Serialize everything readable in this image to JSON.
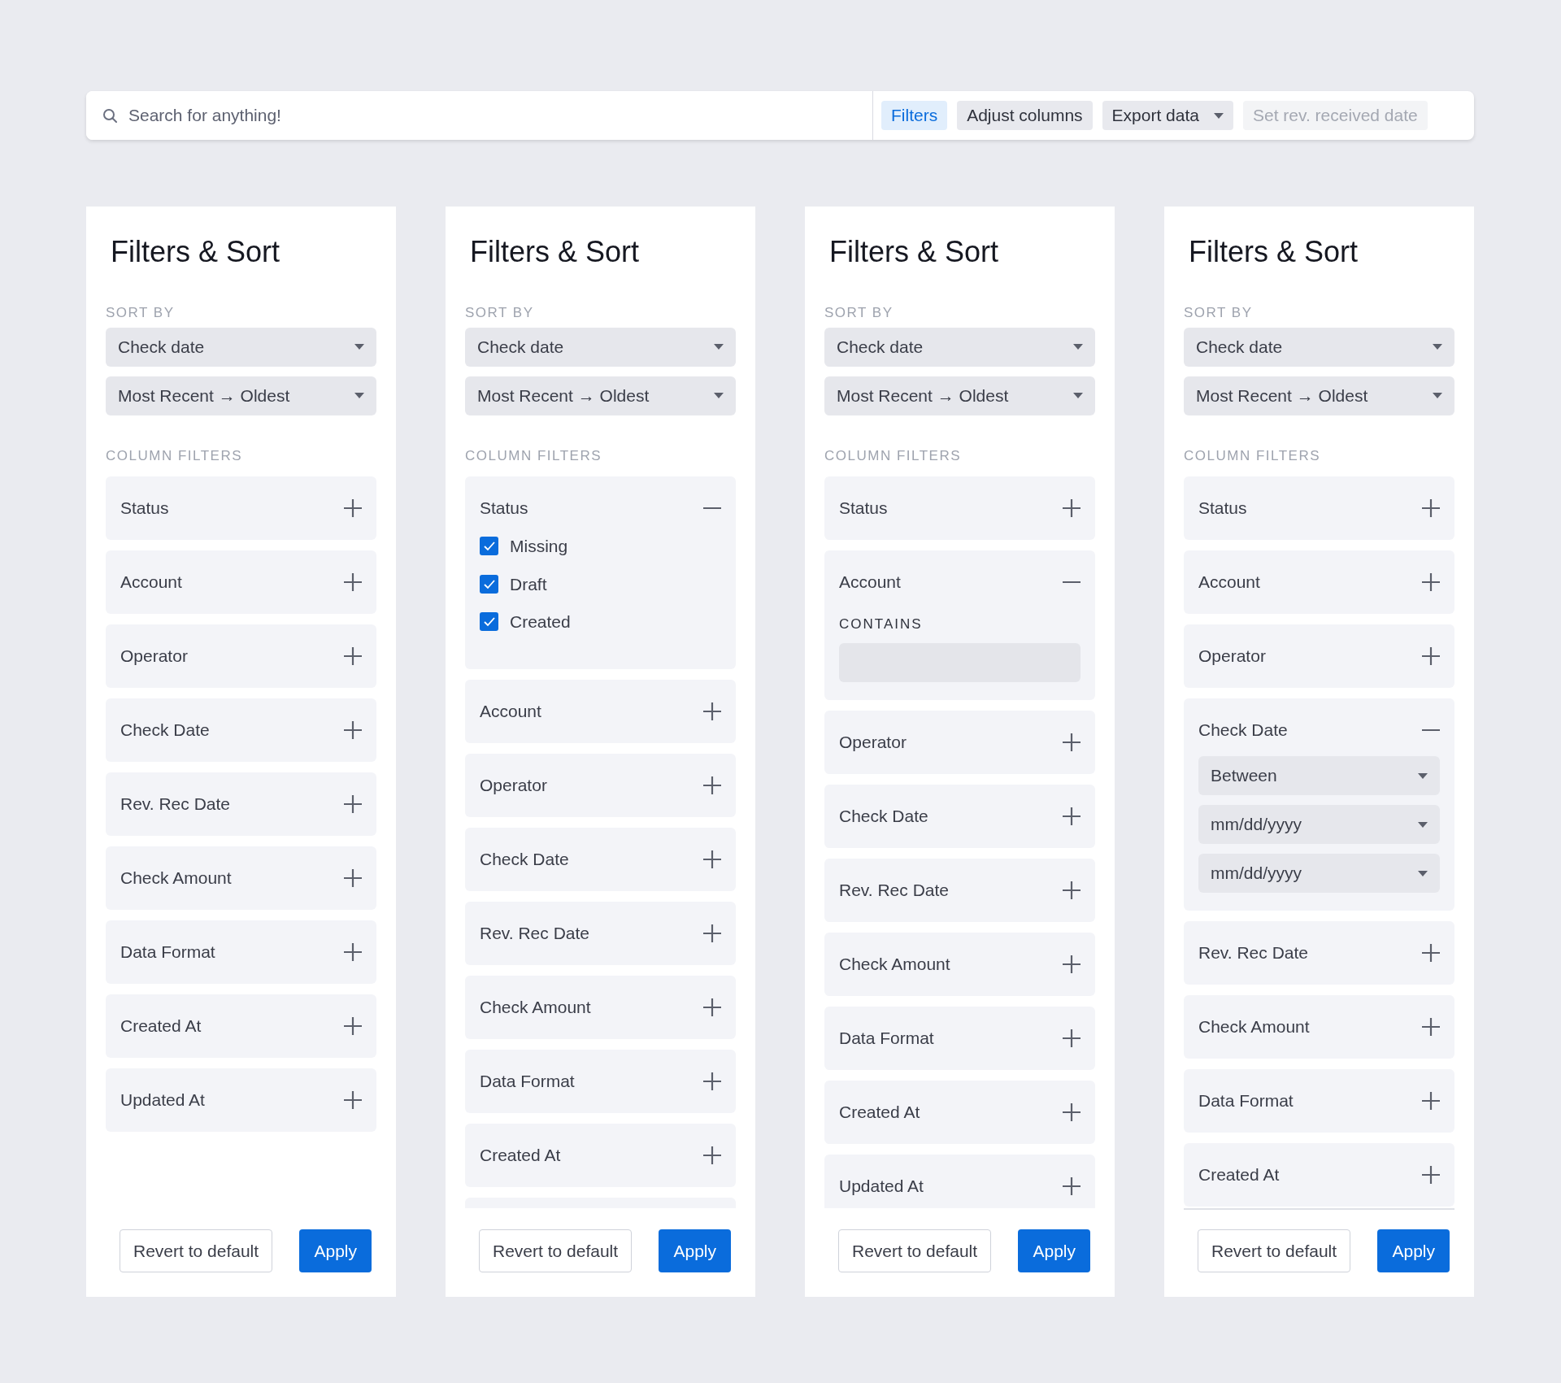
{
  "search": {
    "placeholder": "Search for anything!"
  },
  "toolbar": [
    {
      "label": "Filters",
      "kind": "plain",
      "selected": true,
      "disabled": false
    },
    {
      "label": "Adjust columns",
      "kind": "plain",
      "selected": false,
      "disabled": false
    },
    {
      "label": "Export data",
      "kind": "dropdown",
      "selected": false,
      "disabled": false
    },
    {
      "label": "Set rev. received date",
      "kind": "plain",
      "selected": false,
      "disabled": true
    }
  ],
  "panels": [
    {
      "title": "Filters & Sort",
      "sort_label": "SORT BY",
      "sort_field": "Check date",
      "sort_order": "Most Recent → Oldest",
      "filters_label": "COLUMN FILTERS",
      "list_clipped": false,
      "footer_divider": false,
      "filters": [
        {
          "label": "Status",
          "expanded": false
        },
        {
          "label": "Account",
          "expanded": false
        },
        {
          "label": "Operator",
          "expanded": false
        },
        {
          "label": "Check Date",
          "expanded": false
        },
        {
          "label": "Rev. Rec Date",
          "expanded": false
        },
        {
          "label": "Check Amount",
          "expanded": false
        },
        {
          "label": "Data Format",
          "expanded": false
        },
        {
          "label": "Created At",
          "expanded": false
        },
        {
          "label": "Updated At",
          "expanded": false
        }
      ],
      "revert": "Revert to default",
      "apply": "Apply"
    },
    {
      "title": "Filters & Sort",
      "sort_label": "SORT BY",
      "sort_field": "Check date",
      "sort_order": "Most Recent → Oldest",
      "filters_label": "COLUMN FILTERS",
      "list_clipped": true,
      "footer_divider": false,
      "filters": [
        {
          "label": "Status",
          "kind": "checklist",
          "expanded": true,
          "options": [
            {
              "label": "Missing",
              "checked": true
            },
            {
              "label": "Draft",
              "checked": true
            },
            {
              "label": "Created",
              "checked": true
            }
          ]
        },
        {
          "label": "Account",
          "expanded": false
        },
        {
          "label": "Operator",
          "expanded": false
        },
        {
          "label": "Check Date",
          "expanded": false
        },
        {
          "label": "Rev. Rec Date",
          "expanded": false
        },
        {
          "label": "Check Amount",
          "expanded": false
        },
        {
          "label": "Data Format",
          "expanded": false
        },
        {
          "label": "Created At",
          "expanded": false
        }
      ],
      "revert": "Revert to default",
      "apply": "Apply"
    },
    {
      "title": "Filters & Sort",
      "sort_label": "SORT BY",
      "sort_field": "Check date",
      "sort_order": "Most Recent → Oldest",
      "filters_label": "COLUMN FILTERS",
      "list_clipped": false,
      "footer_divider": false,
      "filters": [
        {
          "label": "Status",
          "expanded": false
        },
        {
          "label": "Account",
          "kind": "contains",
          "expanded": true,
          "field_label": "CONTAINS"
        },
        {
          "label": "Operator",
          "expanded": false
        },
        {
          "label": "Check Date",
          "expanded": false
        },
        {
          "label": "Rev. Rec Date",
          "expanded": false
        },
        {
          "label": "Check Amount",
          "expanded": false
        },
        {
          "label": "Data Format",
          "expanded": false
        },
        {
          "label": "Created At",
          "expanded": false
        },
        {
          "label": "Updated At",
          "expanded": false
        }
      ],
      "revert": "Revert to default",
      "apply": "Apply"
    },
    {
      "title": "Filters & Sort",
      "sort_label": "SORT BY",
      "sort_field": "Check date",
      "sort_order": "Most Recent → Oldest",
      "filters_label": "COLUMN FILTERS",
      "list_clipped": false,
      "footer_divider": true,
      "filters": [
        {
          "label": "Status",
          "expanded": false
        },
        {
          "label": "Account",
          "expanded": false
        },
        {
          "label": "Operator",
          "expanded": false
        },
        {
          "label": "Check Date",
          "kind": "date_range",
          "expanded": true,
          "selects": [
            "Between",
            "mm/dd/yyyy",
            "mm/dd/yyyy"
          ]
        },
        {
          "label": "Rev. Rec Date",
          "expanded": false
        },
        {
          "label": "Check Amount",
          "expanded": false
        },
        {
          "label": "Data Format",
          "expanded": false
        },
        {
          "label": "Created At",
          "expanded": false
        }
      ],
      "revert": "Revert to default",
      "apply": "Apply"
    }
  ]
}
